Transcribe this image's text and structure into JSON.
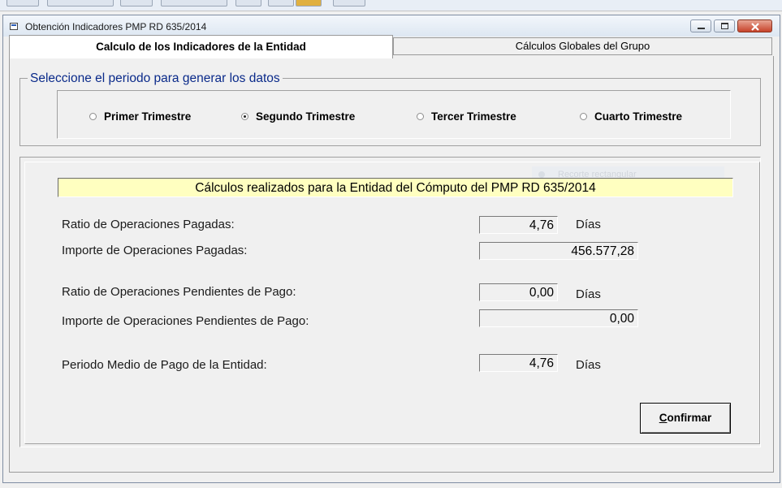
{
  "window": {
    "title": "Obtención Indicadores PMP RD 635/2014"
  },
  "tabs": [
    {
      "label": "Calculo de los Indicadores de la Entidad",
      "active": true
    },
    {
      "label": "Cálculos Globales del Grupo",
      "active": false
    }
  ],
  "period": {
    "legend": "Seleccione el periodo para generar los datos",
    "options": [
      {
        "label": "Primer Trimestre",
        "selected": false
      },
      {
        "label": "Segundo Trimestre",
        "selected": true
      },
      {
        "label": "Tercer Trimestre",
        "selected": false
      },
      {
        "label": "Cuarto Trimestre",
        "selected": false
      }
    ]
  },
  "results": {
    "banner": "Cálculos realizados para la Entidad del Cómputo del PMP RD 635/2014",
    "unit": "Días",
    "rows": [
      {
        "label": "Ratio de Operaciones Pagadas:",
        "value": "4,76",
        "has_unit": true
      },
      {
        "label": "Importe de Operaciones Pagadas:",
        "value": "456.577,28",
        "has_unit": false
      },
      {
        "label": "Ratio de Operaciones Pendientes de Pago:",
        "value": "0,00",
        "has_unit": true
      },
      {
        "label": "Importe de Operaciones Pendientes de Pago:",
        "value": "0,00",
        "has_unit": false
      },
      {
        "label": "Periodo Medio de Pago de la Entidad:",
        "value": "4,76",
        "has_unit": true
      }
    ]
  },
  "overlay_hint": "Recorte rectangular",
  "buttons": {
    "confirm_first": "C",
    "confirm_rest": "onfirmar"
  },
  "colors": {
    "legend_text": "#0a2a8a",
    "banner_bg": "#ffffc0",
    "close_button": "#c7432a"
  }
}
